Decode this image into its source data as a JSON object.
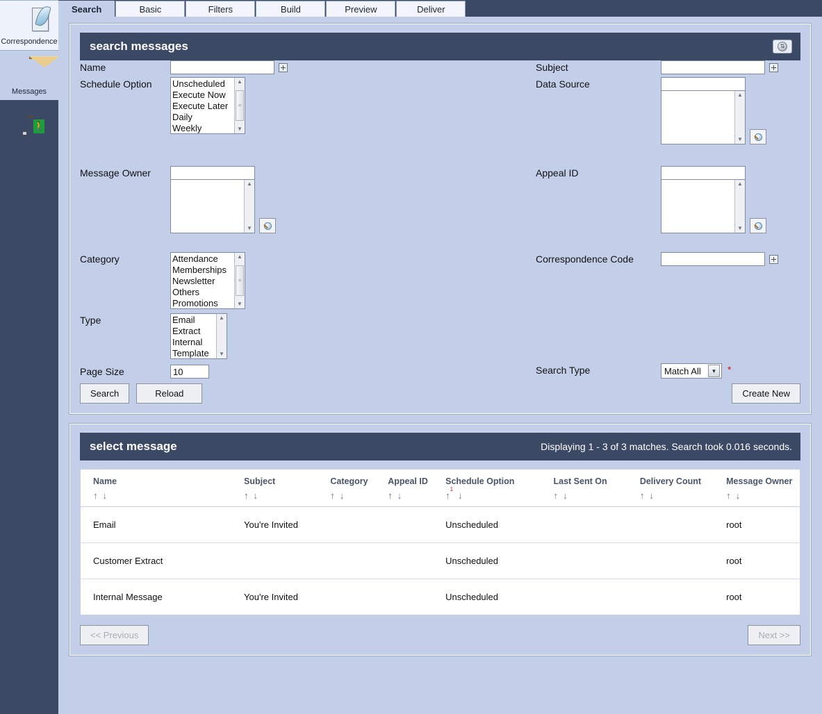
{
  "sidebar": {
    "items": [
      {
        "label": "Correspondence",
        "icon": "quill-icon"
      },
      {
        "label": "Messages",
        "icon": "envelope-icon"
      },
      {
        "label": "",
        "icon": "exit-door-icon"
      }
    ]
  },
  "tabs": [
    {
      "label": "Search",
      "active": true
    },
    {
      "label": "Basic",
      "active": false
    },
    {
      "label": "Filters",
      "active": false
    },
    {
      "label": "Build",
      "active": false
    },
    {
      "label": "Preview",
      "active": false
    },
    {
      "label": "Deliver",
      "active": false
    }
  ],
  "search_panel": {
    "title": "search messages",
    "collapse_glyph": "⇅",
    "fields": {
      "name": {
        "label": "Name",
        "value": "",
        "expand": "expand-icon"
      },
      "schedule_option": {
        "label": "Schedule Option",
        "options": [
          "Unscheduled",
          "Execute Now",
          "Execute Later",
          "Daily",
          "Weekly"
        ]
      },
      "message_owner": {
        "label": "Message Owner",
        "value": "",
        "options": []
      },
      "category": {
        "label": "Category",
        "options": [
          "Attendance",
          "Memberships",
          "Newsletter",
          "Others",
          "Promotions"
        ]
      },
      "type": {
        "label": "Type",
        "options": [
          "Email",
          "Extract",
          "Internal",
          "Template"
        ]
      },
      "page_size": {
        "label": "Page Size",
        "value": "10"
      },
      "subject": {
        "label": "Subject",
        "value": "",
        "expand": "expand-icon"
      },
      "data_source": {
        "label": "Data Source",
        "value": "",
        "options": []
      },
      "appeal_id": {
        "label": "Appeal ID",
        "value": "",
        "options": []
      },
      "correspondence_code": {
        "label": "Correspondence Code",
        "value": "",
        "expand": "expand-icon"
      },
      "search_type": {
        "label": "Search Type",
        "value": "Match All",
        "required_marker": "*"
      }
    },
    "buttons": {
      "search": "Search",
      "reload": "Reload",
      "create_new": "Create New"
    }
  },
  "results_panel": {
    "title": "select message",
    "status": "Displaying 1 - 3 of 3 matches. Search took 0.016 seconds.",
    "columns": [
      {
        "label": "Name",
        "sort_rank": ""
      },
      {
        "label": "Subject",
        "sort_rank": ""
      },
      {
        "label": "Category",
        "sort_rank": ""
      },
      {
        "label": "Appeal ID",
        "sort_rank": ""
      },
      {
        "label": "Schedule Option",
        "sort_rank": "1"
      },
      {
        "label": "Last Sent On",
        "sort_rank": ""
      },
      {
        "label": "Delivery Count",
        "sort_rank": ""
      },
      {
        "label": "Message Owner",
        "sort_rank": ""
      }
    ],
    "sort_asc_glyph": "↑",
    "sort_desc_glyph": "↓",
    "rows": [
      {
        "name": "Email",
        "subject": "You're Invited",
        "category": "",
        "appeal_id": "",
        "schedule_option": "Unscheduled",
        "last_sent_on": "",
        "delivery_count": "",
        "message_owner": "root"
      },
      {
        "name": "Customer Extract",
        "subject": "",
        "category": "",
        "appeal_id": "",
        "schedule_option": "Unscheduled",
        "last_sent_on": "",
        "delivery_count": "",
        "message_owner": "root"
      },
      {
        "name": "Internal Message",
        "subject": "You're Invited",
        "category": "",
        "appeal_id": "",
        "schedule_option": "Unscheduled",
        "last_sent_on": "",
        "delivery_count": "",
        "message_owner": "root"
      }
    ],
    "pagination": {
      "previous": "<< Previous",
      "next": "Next >>"
    }
  },
  "colors": {
    "chrome_dark": "#3c4965",
    "page_bg": "#c3cfe8",
    "required": "#d31414",
    "sort_rank": "#cc2222"
  }
}
